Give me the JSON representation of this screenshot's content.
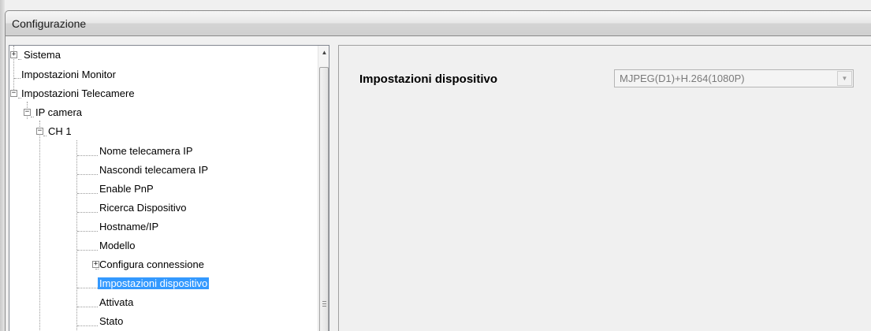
{
  "window": {
    "title": "Configurazione"
  },
  "tree": {
    "items": [
      {
        "label": "Sistema"
      },
      {
        "label": "Impostazioni Monitor"
      },
      {
        "label": "Impostazioni Telecamere"
      },
      {
        "label": "IP camera"
      },
      {
        "label": "CH 1"
      },
      {
        "label": "Nome telecamera IP"
      },
      {
        "label": "Nascondi telecamera IP"
      },
      {
        "label": "Enable PnP"
      },
      {
        "label": "Ricerca Dispositivo"
      },
      {
        "label": "Hostname/IP"
      },
      {
        "label": "Modello"
      },
      {
        "label": "Configura connessione"
      },
      {
        "label": "Impostazioni dispositivo",
        "selected": true
      },
      {
        "label": "Attivata"
      },
      {
        "label": "Stato"
      }
    ]
  },
  "settings": {
    "device_settings_label": "Impostazioni dispositivo",
    "device_settings_value": "MJPEG(D1)+H.264(1080P)"
  },
  "icons": {
    "expand": "plus-box-icon",
    "collapse": "minus-box-icon",
    "scroll_up": "up-arrow-icon",
    "dropdown": "chevron-down-icon"
  },
  "colors": {
    "selection": "#3399ff",
    "window_bg": "#f0f0f0"
  }
}
